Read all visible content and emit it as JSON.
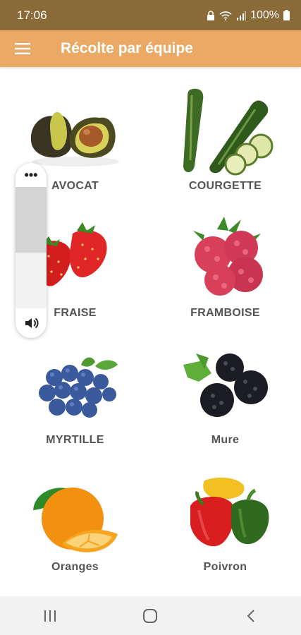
{
  "status": {
    "time": "17:06",
    "battery": "100%"
  },
  "appbar": {
    "title": "Récolte par équipe"
  },
  "items": [
    {
      "label": "AVOCAT",
      "icon": "avocado-icon"
    },
    {
      "label": "COURGETTE",
      "icon": "zucchini-icon"
    },
    {
      "label": "FRAISE",
      "icon": "strawberry-icon"
    },
    {
      "label": "FRAMBOISE",
      "icon": "raspberry-icon"
    },
    {
      "label": "MYRTILLE",
      "icon": "blueberry-icon"
    },
    {
      "label": "Mure",
      "icon": "blackberry-icon"
    },
    {
      "label": "Oranges",
      "icon": "orange-icon"
    },
    {
      "label": "Poivron",
      "icon": "pepper-icon"
    }
  ],
  "volume": {
    "level": 0.46
  },
  "colors": {
    "statusbar": "#8a6a38",
    "appbar": "#eaaa66",
    "label": "#555555"
  }
}
